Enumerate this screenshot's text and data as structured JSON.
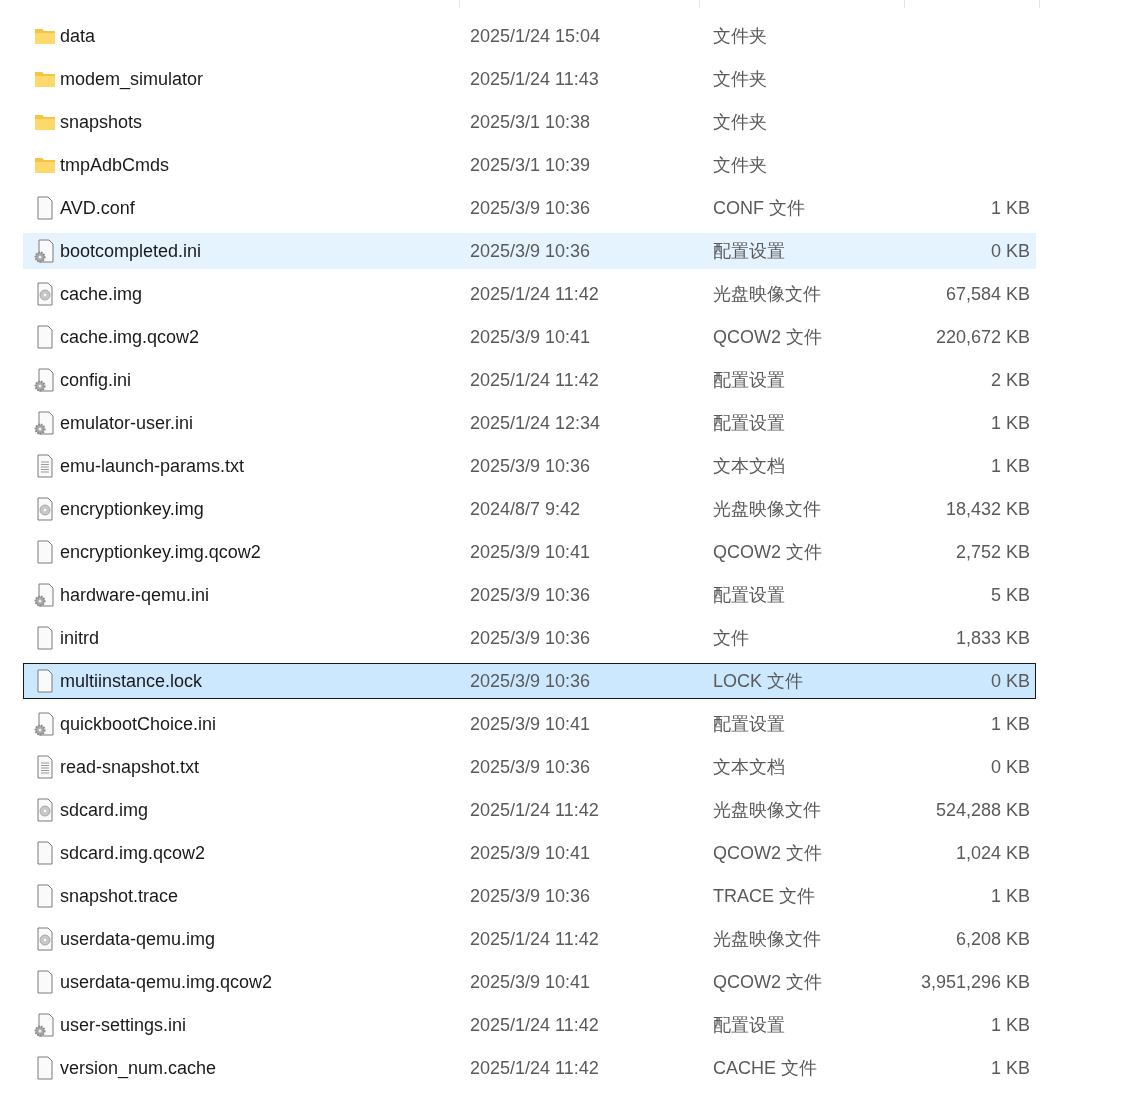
{
  "files": [
    {
      "name": "data",
      "modified": "2025/1/24 15:04",
      "type": "文件夹",
      "kind": "folder",
      "selected": false,
      "hovered": false
    },
    {
      "name": "modem_simulator",
      "modified": "2025/1/24 11:43",
      "type": "文件夹",
      "kind": "folder",
      "selected": false,
      "hovered": false
    },
    {
      "name": "snapshots",
      "modified": "2025/3/1 10:38",
      "type": "文件夹",
      "kind": "folder",
      "selected": false,
      "hovered": false
    },
    {
      "name": "tmpAdbCmds",
      "modified": "2025/3/1 10:39",
      "type": "文件夹",
      "kind": "folder",
      "selected": false,
      "hovered": false
    },
    {
      "name": "AVD.conf",
      "modified": "2025/3/9 10:36",
      "type": "CONF 文件",
      "size": "1 KB",
      "kind": "file",
      "selected": false,
      "hovered": false
    },
    {
      "name": "bootcompleted.ini",
      "modified": "2025/3/9 10:36",
      "type": "配置设置",
      "size": "0 KB",
      "kind": "settings",
      "selected": false,
      "hovered": true
    },
    {
      "name": "cache.img",
      "modified": "2025/1/24 11:42",
      "type": "光盘映像文件",
      "size": "67,584 KB",
      "kind": "disc",
      "selected": false,
      "hovered": false
    },
    {
      "name": "cache.img.qcow2",
      "modified": "2025/3/9 10:41",
      "type": "QCOW2 文件",
      "size": "220,672 KB",
      "kind": "file",
      "selected": false,
      "hovered": false
    },
    {
      "name": "config.ini",
      "modified": "2025/1/24 11:42",
      "type": "配置设置",
      "size": "2 KB",
      "kind": "settings",
      "selected": false,
      "hovered": false
    },
    {
      "name": "emulator-user.ini",
      "modified": "2025/1/24 12:34",
      "type": "配置设置",
      "size": "1 KB",
      "kind": "settings",
      "selected": false,
      "hovered": false
    },
    {
      "name": "emu-launch-params.txt",
      "modified": "2025/3/9 10:36",
      "type": "文本文档",
      "size": "1 KB",
      "kind": "text",
      "selected": false,
      "hovered": false
    },
    {
      "name": "encryptionkey.img",
      "modified": "2024/8/7 9:42",
      "type": "光盘映像文件",
      "size": "18,432 KB",
      "kind": "disc",
      "selected": false,
      "hovered": false
    },
    {
      "name": "encryptionkey.img.qcow2",
      "modified": "2025/3/9 10:41",
      "type": "QCOW2 文件",
      "size": "2,752 KB",
      "kind": "file",
      "selected": false,
      "hovered": false
    },
    {
      "name": "hardware-qemu.ini",
      "modified": "2025/3/9 10:36",
      "type": "配置设置",
      "size": "5 KB",
      "kind": "settings",
      "selected": false,
      "hovered": false
    },
    {
      "name": "initrd",
      "modified": "2025/3/9 10:36",
      "type": "文件",
      "size": "1,833 KB",
      "kind": "file",
      "selected": false,
      "hovered": false
    },
    {
      "name": "multiinstance.lock",
      "modified": "2025/3/9 10:36",
      "type": "LOCK 文件",
      "size": "0 KB",
      "kind": "file",
      "selected": true,
      "hovered": false
    },
    {
      "name": "quickbootChoice.ini",
      "modified": "2025/3/9 10:41",
      "type": "配置设置",
      "size": "1 KB",
      "kind": "settings",
      "selected": false,
      "hovered": false
    },
    {
      "name": "read-snapshot.txt",
      "modified": "2025/3/9 10:36",
      "type": "文本文档",
      "size": "0 KB",
      "kind": "text",
      "selected": false,
      "hovered": false
    },
    {
      "name": "sdcard.img",
      "modified": "2025/1/24 11:42",
      "type": "光盘映像文件",
      "size": "524,288 KB",
      "kind": "disc",
      "selected": false,
      "hovered": false
    },
    {
      "name": "sdcard.img.qcow2",
      "modified": "2025/3/9 10:41",
      "type": "QCOW2 文件",
      "size": "1,024 KB",
      "kind": "file",
      "selected": false,
      "hovered": false
    },
    {
      "name": "snapshot.trace",
      "modified": "2025/3/9 10:36",
      "type": "TRACE 文件",
      "size": "1 KB",
      "kind": "file",
      "selected": false,
      "hovered": false
    },
    {
      "name": "userdata-qemu.img",
      "modified": "2025/1/24 11:42",
      "type": "光盘映像文件",
      "size": "6,208 KB",
      "kind": "disc",
      "selected": false,
      "hovered": false
    },
    {
      "name": "userdata-qemu.img.qcow2",
      "modified": "2025/3/9 10:41",
      "type": "QCOW2 文件",
      "size": "3,951,296 KB",
      "kind": "file",
      "selected": false,
      "hovered": false
    },
    {
      "name": "user-settings.ini",
      "modified": "2025/1/24 11:42",
      "type": "配置设置",
      "size": "1 KB",
      "kind": "settings",
      "selected": false,
      "hovered": false
    },
    {
      "name": "version_num.cache",
      "modified": "2025/1/24 11:42",
      "type": "CACHE 文件",
      "size": "1 KB",
      "kind": "file",
      "selected": false,
      "hovered": false
    }
  ]
}
